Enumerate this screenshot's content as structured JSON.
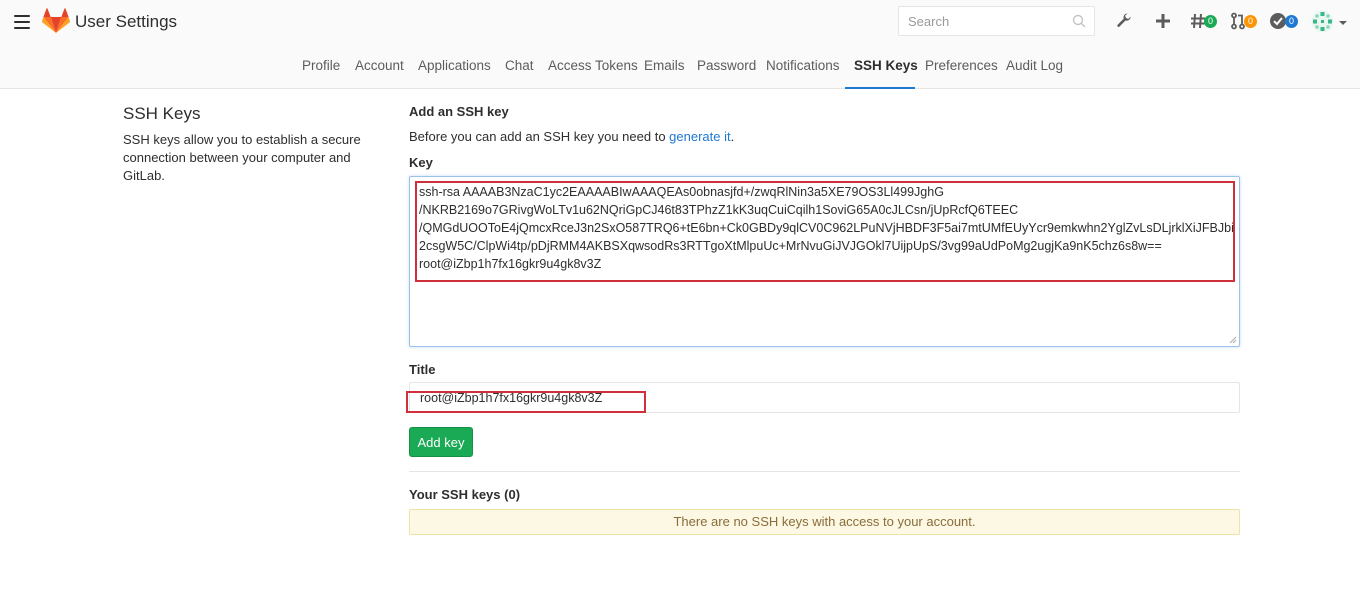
{
  "header": {
    "title": "User Settings",
    "search_placeholder": "Search",
    "badges": {
      "issues": "0",
      "merge_requests": "0",
      "todos": "0"
    },
    "icons": [
      "hamburger-icon",
      "gitlab-logo",
      "search-icon",
      "wrench-icon",
      "plus-icon",
      "issues-icon",
      "merge-request-icon",
      "todo-icon",
      "avatar",
      "chevron-down-icon"
    ]
  },
  "tabs": [
    {
      "label": "Profile"
    },
    {
      "label": "Account"
    },
    {
      "label": "Applications"
    },
    {
      "label": "Chat"
    },
    {
      "label": "Access Tokens"
    },
    {
      "label": "Emails"
    },
    {
      "label": "Password"
    },
    {
      "label": "Notifications"
    },
    {
      "label": "SSH Keys",
      "active": true
    },
    {
      "label": "Preferences"
    },
    {
      "label": "Audit Log"
    }
  ],
  "sidebar": {
    "title": "SSH Keys",
    "description": "SSH keys allow you to establish a secure connection between your computer and GitLab."
  },
  "form": {
    "heading": "Add an SSH key",
    "intro_prefix": "Before you can add an SSH key you need to ",
    "intro_link": "generate it",
    "intro_suffix": ".",
    "key_label": "Key",
    "key_value": "ssh-rsa AAAAB3NzaC1yc2EAAAABIwAAAQEAs0obnasjfd+/zwqRlNin3a5XE79OS3Ll499JghG\n/NKRB2169o7GRivgWoLTv1u62NQriGpCJ46t83TPhzZ1kK3uqCuiCqilh1SoviG65A0cJLCsn/jUpRcfQ6TEEC\n/QMGdUOOToE4jQmcxRceJ3n2SxO587TRQ6+tE6bn+Ck0GBDy9qlCV0C962LPuNVjHBDF3F5ai7mtUMfEUyYcr9emkwhn2YglZvLsDLjrklXiJFBJbi2csgW5C/ClpWi4tp/pDjRMM4AKBSXqwsodRs3RTTgoXtMlpuUc+MrNvuGiJVJGOkl7UijpUpS/3vg99aUdPoMg2ugjKa9nK5chz6s8w==\nroot@iZbp1h7fx16gkr9u4gk8v3Z",
    "title_label": "Title",
    "title_value": "root@iZbp1h7fx16gkr9u4gk8v3Z",
    "submit_label": "Add key"
  },
  "keys_list": {
    "heading": "Your SSH keys (0)",
    "empty_message": "There are no SSH keys with access to your account."
  },
  "colors": {
    "accent": "#1f78d1",
    "success": "#1aaa55",
    "highlight": "#d0303b",
    "warning_bg": "#fcf8e3",
    "warning_text": "#8a6d3b"
  }
}
